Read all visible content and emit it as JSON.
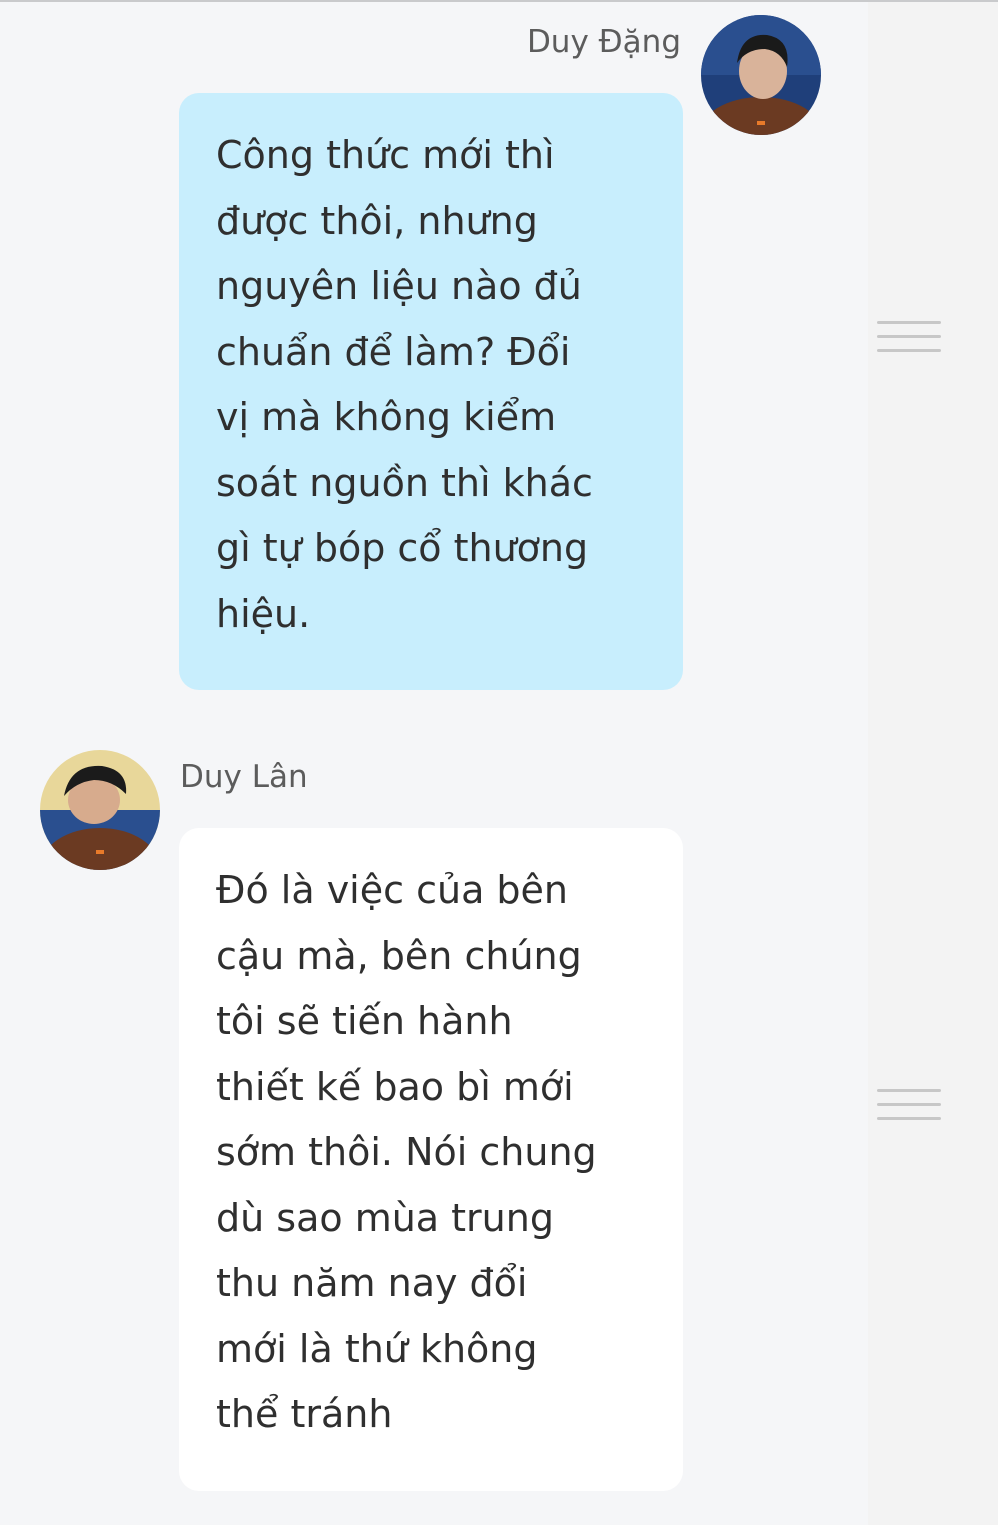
{
  "messages": [
    {
      "sender": "Duy Đặng",
      "side": "right",
      "bubble_color": "#c8eefd",
      "text": "Công thức mới thì được thôi, nhưng nguyên liệu nào đủ chuẩn để làm? Đổi vị mà không kiểm soát nguồn thì khác gì tự bóp cổ thương hiệu.",
      "lines": [
        "Công thức mới thì",
        "được thôi, nhưng",
        "nguyên liệu nào đủ",
        "chuẩn để làm? Đổi",
        "vị mà không kiểm",
        "soát nguồn thì khác",
        "gì tự bóp cổ thương",
        "hiệu."
      ]
    },
    {
      "sender": "Duy Lân",
      "side": "left",
      "bubble_color": "#ffffff",
      "text": "Đó là việc của bên cậu mà, bên chúng tôi sẽ tiến hành thiết kế bao bì mới sớm thôi. Nói chung dù sao mùa trung thu năm nay đổi mới là thứ không thể tránh",
      "lines": [
        "Đó là việc của bên",
        "cậu mà, bên chúng",
        "tôi sẽ tiến hành",
        "thiết kế bao bì mới",
        "sớm thôi. Nói chung",
        "dù sao mùa trung",
        "thu năm nay đổi",
        "mới là thứ không",
        "thể tránh"
      ]
    }
  ],
  "icons": {
    "menu_handle": "hamburger-icon"
  },
  "colors": {
    "background": "#f5f6f8",
    "name_text": "#5c5c5c",
    "body_text": "#2f2f2f",
    "handle": "#c7c7c7"
  }
}
